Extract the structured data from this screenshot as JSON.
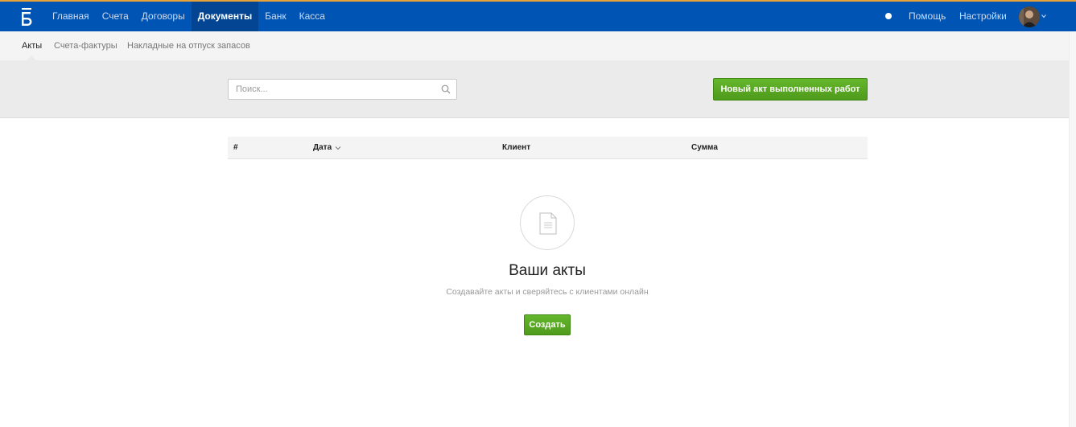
{
  "colors": {
    "topbar": "#0054b4",
    "topbar_active": "#034493",
    "accent_green": "#5aaa24",
    "top_stripe": "#e8a23a"
  },
  "logo": {
    "letter": "Б"
  },
  "nav": {
    "items": [
      {
        "label": "Главная"
      },
      {
        "label": "Счета"
      },
      {
        "label": "Договоры"
      },
      {
        "label": "Документы",
        "active": true
      },
      {
        "label": "Банк"
      },
      {
        "label": "Касса"
      }
    ],
    "help_label": "Помощь",
    "settings_label": "Настройки"
  },
  "subnav": {
    "items": [
      {
        "label": "Акты",
        "active": true
      },
      {
        "label": "Счета-фактуры"
      },
      {
        "label": "Накладные на отпуск запасов"
      }
    ]
  },
  "toolbar": {
    "search_placeholder": "Поиск...",
    "new_button_label": "Новый акт выполненных работ"
  },
  "table": {
    "columns": [
      "#",
      "Дата",
      "Клиент",
      "Сумма"
    ],
    "sort_column": "Дата"
  },
  "empty_state": {
    "title": "Ваши акты",
    "subtitle": "Создавайте акты и сверяйтесь с клиентами онлайн",
    "button_label": "Создать",
    "icon": "document-icon"
  }
}
